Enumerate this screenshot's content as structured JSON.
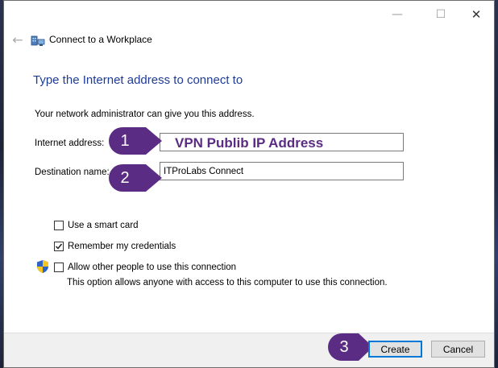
{
  "window": {
    "minimize_glyph": "—",
    "maximize_glyph": "☐",
    "close_glyph": "✕"
  },
  "nav": {
    "back_glyph": "←",
    "title": "Connect to a Workplace"
  },
  "content": {
    "heading": "Type the Internet address to connect to",
    "info": "Your network administrator can give you this address.",
    "internet_address_label": "Internet address:",
    "internet_address_value": "",
    "internet_address_overlay": "VPN Publib IP Address",
    "destination_name_label": "Destination name:",
    "destination_name_value": "ITProLabs Connect"
  },
  "options": {
    "smart_card": {
      "label": "Use a smart card",
      "checked": false
    },
    "remember": {
      "label": "Remember my credentials",
      "checked": true
    },
    "allow_others": {
      "label": "Allow other people to use this connection",
      "checked": false
    },
    "allow_note": "This option allows anyone with access to this computer to use this connection."
  },
  "callouts": [
    "1",
    "2",
    "3"
  ],
  "buttons": {
    "create": "Create",
    "cancel": "Cancel"
  },
  "colors": {
    "heading": "#1e3c96",
    "callout": "#5b2c83",
    "focus_border": "#0078d7"
  },
  "icons": {
    "back": "back-arrow-icon",
    "wizard": "network-workplace-icon",
    "shield": "uac-shield-icon"
  }
}
